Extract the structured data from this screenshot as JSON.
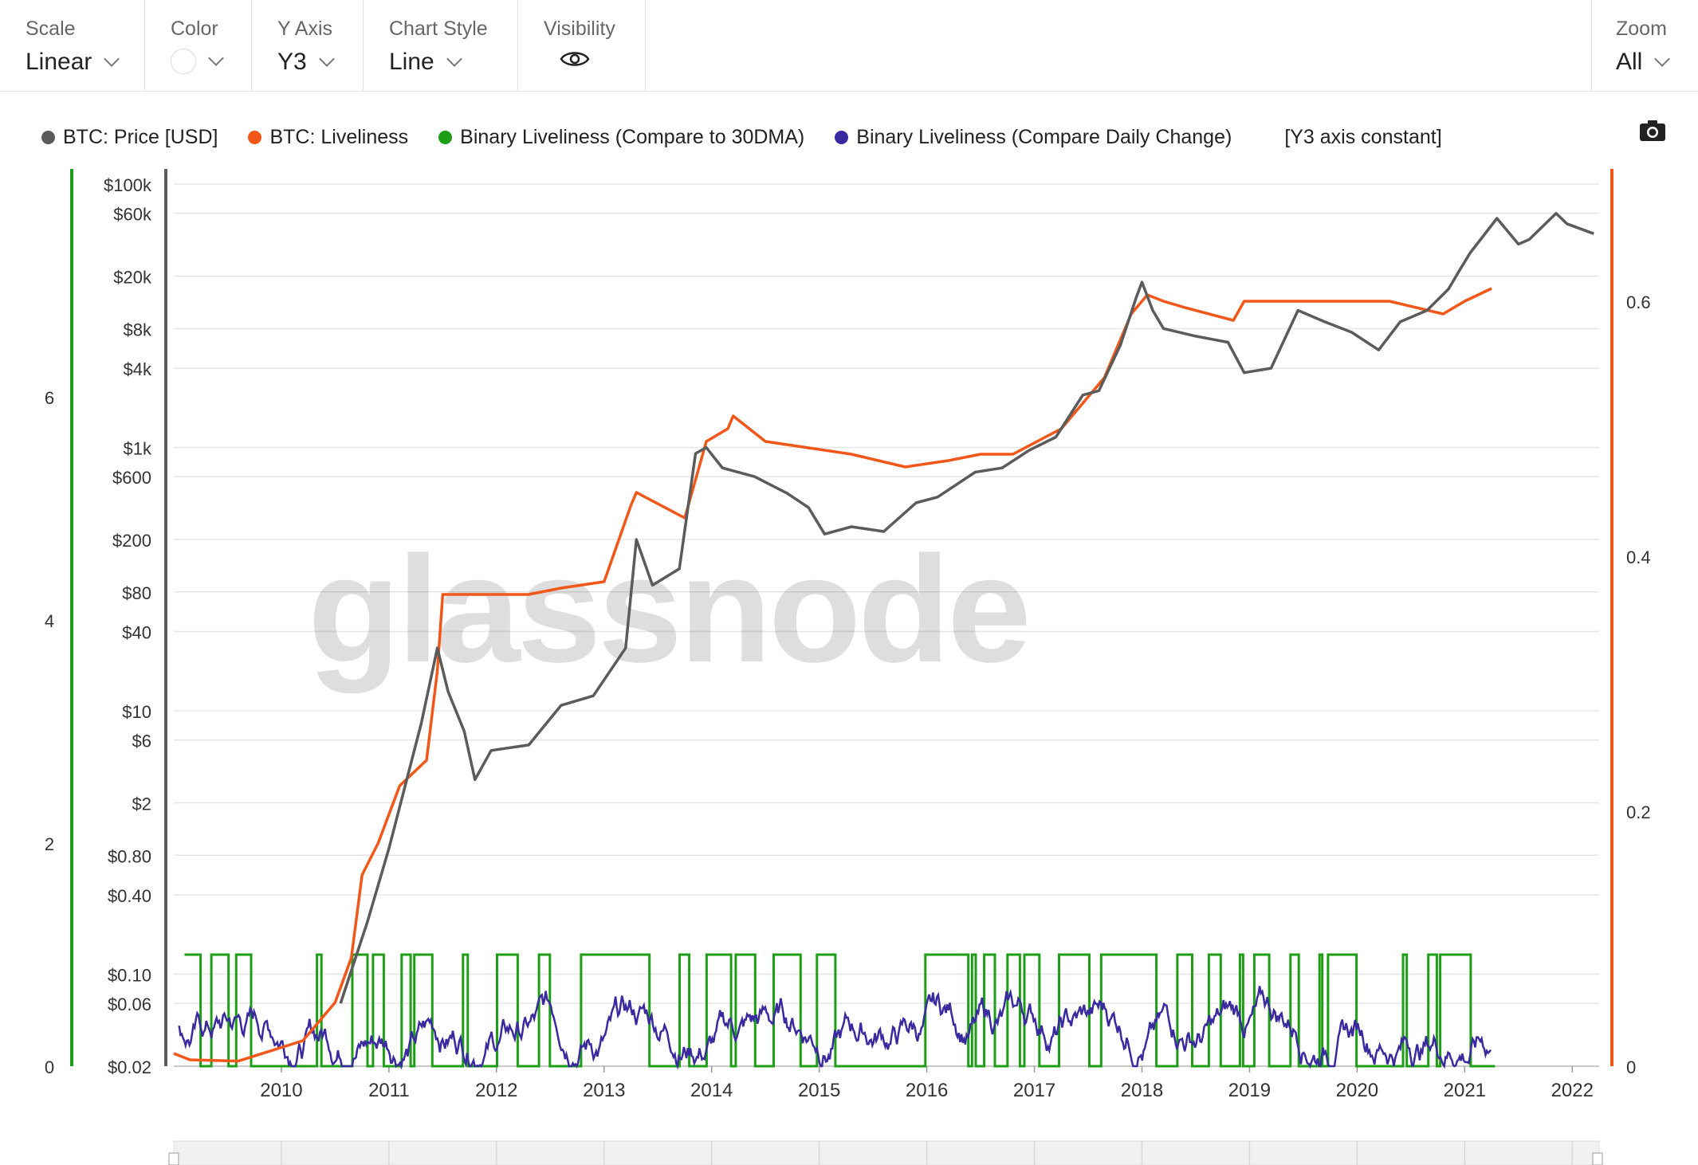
{
  "toolbar": {
    "scale": {
      "label": "Scale",
      "value": "Linear"
    },
    "color": {
      "label": "Color"
    },
    "yaxis": {
      "label": "Y Axis",
      "value": "Y3"
    },
    "chart_style": {
      "label": "Chart Style",
      "value": "Line"
    },
    "visibility": {
      "label": "Visibility"
    },
    "zoom": {
      "label": "Zoom",
      "value": "All"
    }
  },
  "legend": [
    {
      "label": "BTC: Price [USD]",
      "color": "#5b5b5b"
    },
    {
      "label": "BTC: Liveliness",
      "color": "#f2571a"
    },
    {
      "label": "Binary Liveliness (Compare to 30DMA)",
      "color": "#1d9e16"
    },
    {
      "label": "Binary Liveliness (Compare Daily Change)",
      "color": "#3a2aa0"
    }
  ],
  "legend_note": "[Y3 axis constant]",
  "watermark": "glassnode",
  "chart_data": {
    "type": "line",
    "x_ticks": [
      "2010",
      "2011",
      "2012",
      "2013",
      "2014",
      "2015",
      "2016",
      "2017",
      "2018",
      "2019",
      "2020",
      "2021",
      "2022"
    ],
    "x_range": [
      2009.0,
      2022.25
    ],
    "price_axis": {
      "scale": "log",
      "range": [
        0.02,
        120000
      ],
      "tick_labels": [
        "$100k",
        "$60k",
        "$20k",
        "$8k",
        "$4k",
        "$1k",
        "$600",
        "$200",
        "$80",
        "$40",
        "$10",
        "$6",
        "$2",
        "$0.80",
        "$0.40",
        "$0.10",
        "$0.06",
        "$0.02"
      ],
      "tick_values": [
        100000,
        60000,
        20000,
        8000,
        4000,
        1000,
        600,
        200,
        80,
        40,
        10,
        6,
        2,
        0.8,
        0.4,
        0.1,
        0.06,
        0.02
      ]
    },
    "liveliness_axis": {
      "range": [
        0,
        0.7
      ],
      "ticks": [
        0,
        0.2,
        0.4,
        0.6
      ],
      "tick_labels": [
        "0",
        "0.2",
        "0.4",
        "0.6"
      ]
    },
    "binary_axis": {
      "range": [
        0,
        8
      ],
      "ticks": [
        0,
        2,
        4,
        6
      ],
      "tick_labels": [
        "0",
        "2",
        "4",
        "6"
      ]
    },
    "series": [
      {
        "name": "BTC: Price [USD]",
        "axis": "price",
        "color": "#5b5b5b",
        "x": [
          2010.55,
          2010.8,
          2011.0,
          2011.3,
          2011.45,
          2011.55,
          2011.7,
          2011.8,
          2011.95,
          2012.3,
          2012.6,
          2012.9,
          2013.2,
          2013.3,
          2013.45,
          2013.7,
          2013.85,
          2013.95,
          2014.1,
          2014.4,
          2014.7,
          2014.9,
          2015.05,
          2015.3,
          2015.6,
          2015.9,
          2016.1,
          2016.45,
          2016.7,
          2016.95,
          2017.2,
          2017.45,
          2017.6,
          2017.8,
          2017.95,
          2018.0,
          2018.1,
          2018.2,
          2018.5,
          2018.8,
          2018.95,
          2019.2,
          2019.45,
          2019.7,
          2019.95,
          2020.2,
          2020.4,
          2020.65,
          2020.85,
          2020.95,
          2021.05,
          2021.3,
          2021.5,
          2021.6,
          2021.85,
          2021.95,
          2022.2
        ],
        "y": [
          0.06,
          0.25,
          0.9,
          8,
          30,
          14,
          7,
          3,
          5,
          5.5,
          11,
          13,
          30,
          200,
          90,
          120,
          900,
          1000,
          700,
          600,
          450,
          350,
          220,
          250,
          230,
          380,
          420,
          650,
          700,
          950,
          1200,
          2500,
          2700,
          6000,
          14000,
          18000,
          11000,
          8000,
          7000,
          6300,
          3700,
          4000,
          11000,
          9000,
          7500,
          5500,
          9000,
          11000,
          16000,
          22000,
          30000,
          55000,
          35000,
          38000,
          60000,
          50000,
          42000
        ]
      },
      {
        "name": "BTC: Liveliness",
        "axis": "liveliness",
        "color": "#f2571a",
        "x": [
          2009.0,
          2009.15,
          2009.6,
          2010.2,
          2010.5,
          2010.65,
          2010.75,
          2010.9,
          2011.1,
          2011.35,
          2011.45,
          2011.5,
          2011.75,
          2011.95,
          2012.3,
          2012.6,
          2013.0,
          2013.25,
          2013.3,
          2013.75,
          2013.95,
          2014.15,
          2014.2,
          2014.5,
          2014.9,
          2015.3,
          2015.8,
          2016.2,
          2016.5,
          2016.8,
          2017.25,
          2017.45,
          2017.65,
          2017.9,
          2018.0,
          2018.05,
          2018.2,
          2018.4,
          2018.85,
          2018.95,
          2019.1,
          2019.5,
          2019.9,
          2020.3,
          2020.8,
          2021.0,
          2021.25
        ],
        "y": [
          0.01,
          0.005,
          0.004,
          0.02,
          0.05,
          0.085,
          0.15,
          0.175,
          0.22,
          0.24,
          0.31,
          0.37,
          0.37,
          0.37,
          0.37,
          0.375,
          0.38,
          0.44,
          0.45,
          0.43,
          0.49,
          0.5,
          0.51,
          0.49,
          0.485,
          0.48,
          0.47,
          0.475,
          0.48,
          0.48,
          0.5,
          0.52,
          0.54,
          0.59,
          0.6,
          0.605,
          0.6,
          0.595,
          0.585,
          0.6,
          0.6,
          0.6,
          0.6,
          0.6,
          0.59,
          0.6,
          0.61
        ]
      }
    ],
    "grid": true,
    "legend_position": "top"
  }
}
